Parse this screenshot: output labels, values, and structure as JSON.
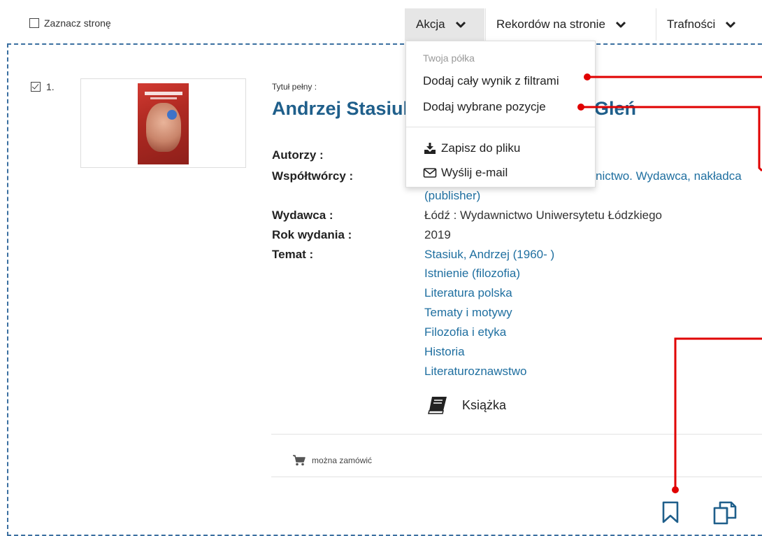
{
  "toolbar": {
    "select_page_label": "Zaznacz stronę",
    "action_label": "Akcja",
    "records_per_page_label": "Rekordów na stronie",
    "sort_label": "Trafności"
  },
  "record": {
    "number": "1.",
    "full_title_label": "Tytuł pełny :",
    "title_left": "Andrzej Stasiuk",
    "title_right": "Gleń",
    "fields": {
      "authors_label": "Autorzy :",
      "contributors_label": "Współtwórcy :",
      "contributors_value_line1": "nictwo. Wydawca, nakładca",
      "contributors_value_line2": "(publisher)",
      "publisher_label": "Wydawca :",
      "publisher_value": "Łódź : Wydawnictwo Uniwersytetu Łódzkiego",
      "year_label": "Rok wydania :",
      "year_value": "2019",
      "subject_label": "Temat :",
      "subjects": [
        "Stasiuk, Andrzej (1960- )",
        "Istnienie (filozofia)",
        "Literatura polska",
        "Tematy i motywy",
        "Filozofia i etyka",
        "Historia",
        "Literaturoznawstwo"
      ]
    },
    "type_label": "Książka",
    "order_label": "można zamówić"
  },
  "action_menu": {
    "header": "Twoja półka",
    "add_all_with_filters": "Dodaj cały wynik z filtrami",
    "add_selected": "Dodaj wybrane pozycje",
    "save_to_file": "Zapisz do pliku",
    "send_email": "Wyślij e-mail"
  },
  "icons": {
    "book": "book-icon",
    "cart": "cart-icon",
    "download": "download-icon",
    "envelope": "envelope-icon",
    "bookmark": "bookmark-icon",
    "copy": "copy-icon",
    "chevron": "chevron-down-icon"
  },
  "colors": {
    "link": "#1f6fa0",
    "title": "#1f5f8b",
    "callout": "#e00000",
    "frame": "#3a6fa0"
  }
}
